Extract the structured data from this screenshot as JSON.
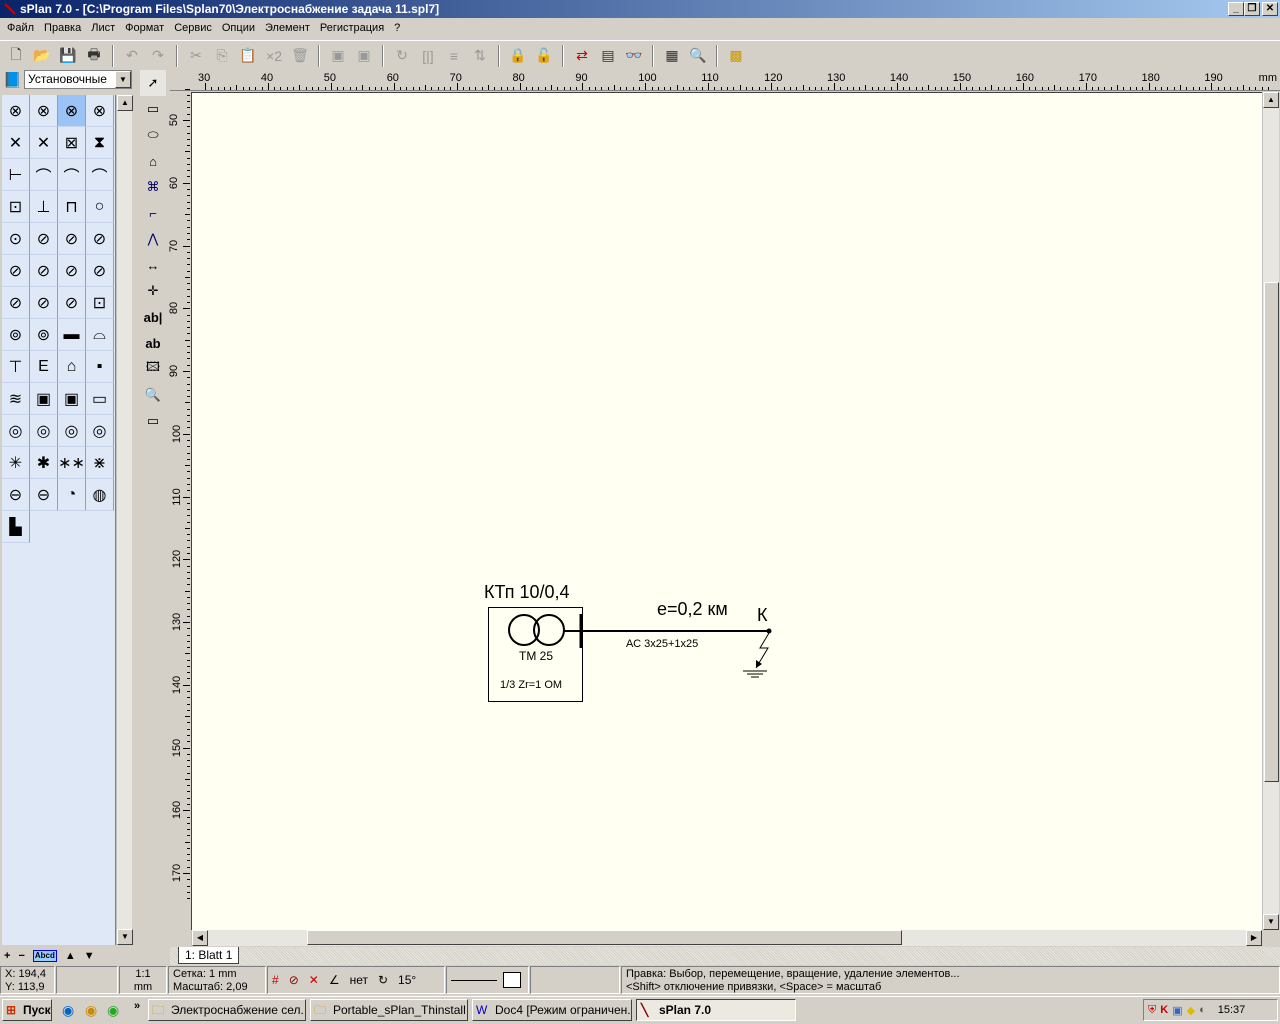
{
  "window": {
    "title": "sPlan 7.0 - [C:\\Program Files\\Splan70\\Электроснабжение задача 11.spl7]",
    "minimize": "_",
    "restore": "❐",
    "close": "✕"
  },
  "menu": [
    "Файл",
    "Правка",
    "Лист",
    "Формат",
    "Сервис",
    "Опции",
    "Элемент",
    "Регистрация",
    "?"
  ],
  "library": {
    "selected": "Установочные"
  },
  "ruler": {
    "unit": "mm",
    "h_ticks": [
      "30",
      "40",
      "50",
      "60",
      "70",
      "80",
      "90",
      "100",
      "110",
      "120",
      "130",
      "140",
      "150",
      "160",
      "170",
      "180",
      "190"
    ],
    "v_ticks": [
      "50",
      "60",
      "70",
      "80",
      "90",
      "100",
      "110",
      "120",
      "130",
      "140",
      "150",
      "160",
      "170"
    ]
  },
  "drawing": {
    "substation": "КТп 10/0,4",
    "transformer": "ТМ 25",
    "impedance": "1/3 Zr=1 OM",
    "length": "е=0,2 км",
    "cable": "АС 3x25+1x25",
    "fault_point": "К"
  },
  "tabs": [
    "1: Blatt 1"
  ],
  "lib_footer": {
    "abbr": "Abcd"
  },
  "status": {
    "x": "X: 194,4",
    "y": "Y: 113,9",
    "scale_ratio": "1:1",
    "scale_unit": "mm",
    "grid": "Сетка: 1 mm",
    "zoom": "Масштаб:   2,09",
    "angle_snap": "нет",
    "rotate": "15°",
    "hint1": "Правка: Выбор, перемещение, вращение, удаление элементов...",
    "hint2": "<Shift> отключение привязки, <Space> = масштаб"
  },
  "taskbar": {
    "start": "Пуск",
    "tasks": [
      "Электроснабжение сел...",
      "Portable_sPlan_Thinstall",
      "Doc4 [Режим ограничен...",
      "sPlan 7.0"
    ],
    "clock": "15:37"
  }
}
